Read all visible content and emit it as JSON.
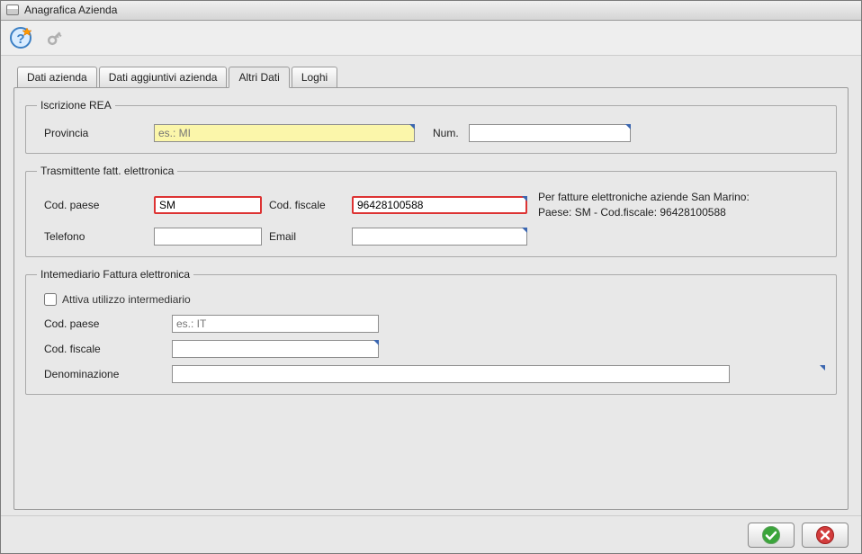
{
  "window": {
    "title": "Anagrafica Azienda"
  },
  "tabs": {
    "items": [
      {
        "label": "Dati azienda"
      },
      {
        "label": "Dati aggiuntivi azienda"
      },
      {
        "label": "Altri Dati"
      },
      {
        "label": "Loghi"
      }
    ],
    "active_index": 2
  },
  "rea": {
    "legend": "Iscrizione REA",
    "provincia_label": "Provincia",
    "provincia_placeholder": "es.: MI",
    "provincia_value": "",
    "num_label": "Num.",
    "num_value": ""
  },
  "trasmittente": {
    "legend": "Trasmittente fatt. elettronica",
    "cod_paese_label": "Cod. paese",
    "cod_paese_value": "SM",
    "cod_fiscale_label": "Cod. fiscale",
    "cod_fiscale_value": "96428100588",
    "telefono_label": "Telefono",
    "telefono_value": "",
    "email_label": "Email",
    "email_value": "",
    "hint_line1": "Per fatture elettroniche aziende San Marino:",
    "hint_line2": "Paese: SM - Cod.fiscale: 96428100588"
  },
  "intermediario": {
    "legend": "Intemediario Fattura elettronica",
    "attiva_label": "Attiva utilizzo intermediario",
    "attiva_checked": false,
    "cod_paese_label": "Cod. paese",
    "cod_paese_placeholder": "es.: IT",
    "cod_paese_value": "",
    "cod_fiscale_label": "Cod. fiscale",
    "cod_fiscale_value": "",
    "denominazione_label": "Denominazione",
    "denominazione_value": ""
  }
}
